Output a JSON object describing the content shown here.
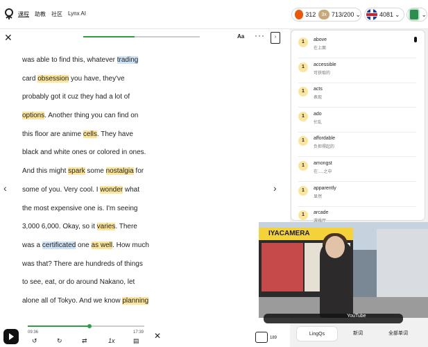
{
  "nav": {
    "items": [
      "课程",
      "助教",
      "社区",
      "Lynx AI"
    ]
  },
  "stats": {
    "streak": "312",
    "multiplier": "3x",
    "progress": "713/200",
    "points": "4081"
  },
  "reader": {
    "font_button": "Aa",
    "more_label": "···",
    "lines": [
      [
        {
          "t": "was able to find this, whatever "
        },
        {
          "t": "trading",
          "h": "b"
        }
      ],
      [
        {
          "t": "card "
        },
        {
          "t": "obsession",
          "h": "y"
        },
        {
          "t": " you have, they've"
        }
      ],
      [
        {
          "t": "probably got it cuz they had a lot of"
        }
      ],
      [
        {
          "t": "options",
          "h": "y"
        },
        {
          "t": ". Another thing you can find on"
        }
      ],
      [
        {
          "t": "this floor are anime "
        },
        {
          "t": "cells",
          "h": "y"
        },
        {
          "t": ". They have"
        }
      ],
      [
        {
          "t": "black and white ones or colored in ones."
        }
      ],
      [
        {
          "t": "And this might "
        },
        {
          "t": "spark",
          "h": "y"
        },
        {
          "t": " some "
        },
        {
          "t": "nostalgia",
          "h": "y"
        },
        {
          "t": " for"
        }
      ],
      [
        {
          "t": "some of you. Very cool. I "
        },
        {
          "t": "wonder",
          "h": "y"
        },
        {
          "t": " what"
        }
      ],
      [
        {
          "t": "the most expensive one is. I'm seeing"
        }
      ],
      [
        {
          "t": "3,000 6,000. Okay, so it "
        },
        {
          "t": "varies",
          "h": "y"
        },
        {
          "t": ". There"
        }
      ],
      [
        {
          "t": "was a "
        },
        {
          "t": "certificated",
          "h": "b"
        },
        {
          "t": " one "
        },
        {
          "t": "as well",
          "h": "y"
        },
        {
          "t": ". How much"
        }
      ],
      [
        {
          "t": "was that? There are hundreds of things"
        }
      ],
      [
        {
          "t": "to see, eat, or do around Nakano, let"
        }
      ],
      [
        {
          "t": "alone all of Tokyo. And we know "
        },
        {
          "t": "planning",
          "h": "y"
        }
      ]
    ]
  },
  "player": {
    "current_time": "09:36",
    "total_time": "17:39",
    "progress": 0.52,
    "speed_label": "1x",
    "reading_progress": 0.44
  },
  "words": [
    {
      "num": "1",
      "word": "above",
      "trans": "在上面"
    },
    {
      "num": "1",
      "word": "accessible",
      "trans": "可获取的"
    },
    {
      "num": "1",
      "word": "acts",
      "trans": "表现"
    },
    {
      "num": "1",
      "word": "ado",
      "trans": "忙乱"
    },
    {
      "num": "1",
      "word": "affordable",
      "trans": "负担得起的"
    },
    {
      "num": "1",
      "word": "amongst",
      "trans": "在.....之中"
    },
    {
      "num": "1",
      "word": "apparently",
      "trans": "显然"
    },
    {
      "num": "1",
      "word": "arcade",
      "trans": "游戏厅"
    }
  ],
  "video": {
    "sign_text": "IYACAMERA",
    "bar_text": "YouTube"
  },
  "tabs": [
    "LingQs",
    "新词",
    "全部单词"
  ],
  "cards_count": "189"
}
